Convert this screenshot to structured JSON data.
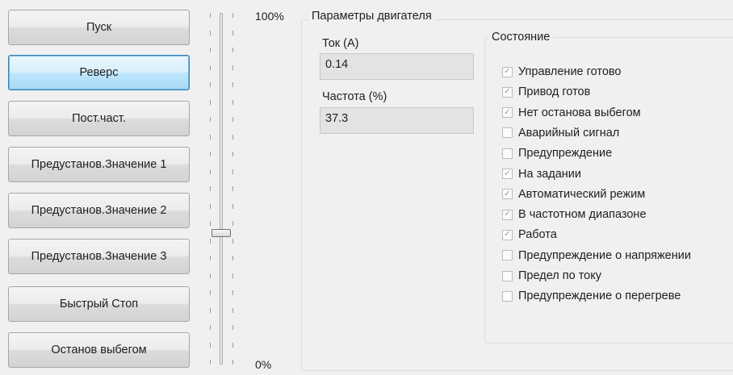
{
  "buttons": [
    {
      "label": "Пуск"
    },
    {
      "label": "Реверс"
    },
    {
      "label": "Пост.част."
    },
    {
      "label": "Предустанов.Значение 1"
    },
    {
      "label": "Предустанов.Значение 2"
    },
    {
      "label": "Предустанов.Значение 3"
    },
    {
      "label": "Быстрый Стоп"
    },
    {
      "label": "Останов выбегом"
    }
  ],
  "slider": {
    "max_label": "100%",
    "min_label": "0%",
    "value_percent": 37
  },
  "params": {
    "title": "Параметры двигателя",
    "current_label": "Ток (A)",
    "current_value": "0.14",
    "freq_label": "Частота (%)",
    "freq_value": "37.3"
  },
  "status": {
    "title": "Состояние",
    "items": [
      {
        "label": "Управление готово",
        "checked": true
      },
      {
        "label": "Привод готов",
        "checked": true
      },
      {
        "label": "Нет останова выбегом",
        "checked": true
      },
      {
        "label": "Аварийный сигнал",
        "checked": false
      },
      {
        "label": "Предупреждение",
        "checked": false
      },
      {
        "label": "На задании",
        "checked": true
      },
      {
        "label": "Автоматический режим",
        "checked": true
      },
      {
        "label": "В частотном диапазоне",
        "checked": true
      },
      {
        "label": "Работа",
        "checked": true
      },
      {
        "label": "Предупреждение о напряжении",
        "checked": false
      },
      {
        "label": "Предел по току",
        "checked": false
      },
      {
        "label": "Предупреждение о перегреве",
        "checked": false
      }
    ]
  }
}
